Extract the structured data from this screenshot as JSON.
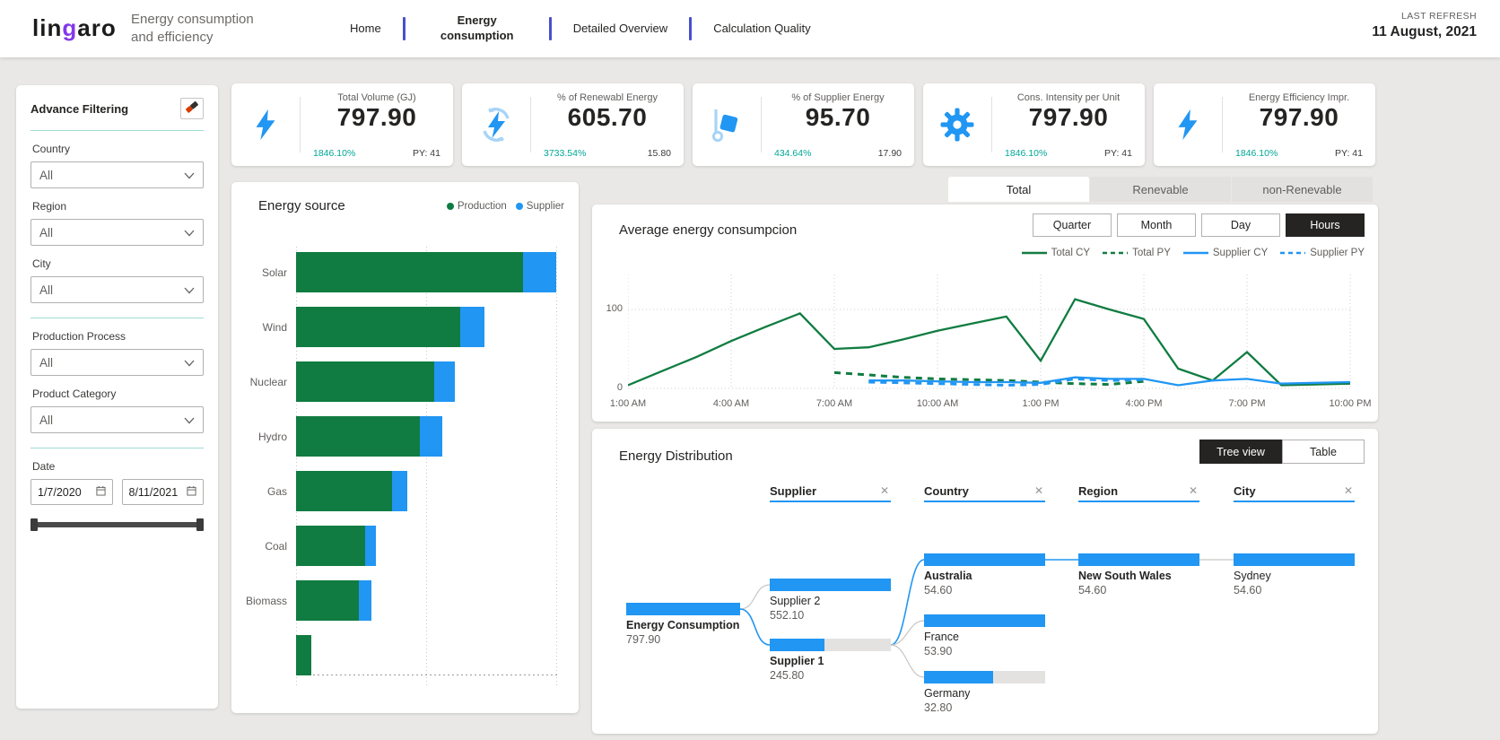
{
  "header": {
    "logo_text": "lingaro",
    "title_line1": "Energy consumption",
    "title_line2": "and efficiency",
    "nav": [
      {
        "label": "Home",
        "active": false
      },
      {
        "label": "Energy consumption",
        "active": true
      },
      {
        "label": "Detailed Overview",
        "active": false
      },
      {
        "label": "Calculation Quality",
        "active": false
      }
    ],
    "last_refresh_label": "LAST REFRESH",
    "last_refresh_date": "11 August, 2021"
  },
  "filters": {
    "title": "Advance Filtering",
    "clear_icon": "eraser-icon",
    "selects": [
      {
        "label": "Country",
        "value": "All"
      },
      {
        "label": "Region",
        "value": "All"
      },
      {
        "label": "City",
        "value": "All"
      },
      {
        "label": "Production Process",
        "value": "All"
      },
      {
        "label": "Product Category",
        "value": "All"
      }
    ],
    "date_label": "Date",
    "date_start": "1/7/2020",
    "date_end": "8/11/2021"
  },
  "kpis": [
    {
      "icon": "bolt-icon",
      "title": "Total Volume (GJ)",
      "value": "797.90",
      "delta": "1846.10%",
      "py": "PY: 41"
    },
    {
      "icon": "renewable-bolt-icon",
      "title": "% of Renewabl Energy",
      "value": "605.70",
      "delta": "3733.54%",
      "py": "15.80"
    },
    {
      "icon": "handtruck-icon",
      "title": "% of Supplier Energy",
      "value": "95.70",
      "delta": "434.64%",
      "py": "17.90"
    },
    {
      "icon": "gear-icon",
      "title": "Cons. Intensity per Unit",
      "value": "797.90",
      "delta": "1846.10%",
      "py": "PY: 41"
    },
    {
      "icon": "bolt-icon",
      "title": "Energy Efficiency Impr.",
      "value": "797.90",
      "delta": "1846.10%",
      "py": "PY: 41"
    }
  ],
  "energy_tabs": [
    {
      "label": "Total",
      "active": true
    },
    {
      "label": "Renevable",
      "active": false
    },
    {
      "label": "non-Renevable",
      "active": false
    }
  ],
  "colors": {
    "production_green": "#107C41",
    "supplier_blue": "#2196F3",
    "delta_green": "#01a796",
    "nav_separator": "#4750ce",
    "logo_purple": "#8338ec"
  },
  "chart_data": [
    {
      "type": "bar",
      "title": "Energy source",
      "orientation": "horizontal",
      "legend": [
        {
          "name": "Production",
          "color": "#107C41"
        },
        {
          "name": "Supplier",
          "color": "#2196F3"
        }
      ],
      "categories": [
        "Solar",
        "Wind",
        "Nuclear",
        "Hydro",
        "Gas",
        "Coal",
        "Biomass",
        ""
      ],
      "series": [
        {
          "name": "Production",
          "values": [
            253,
            183,
            154,
            138,
            107,
            77,
            70,
            17
          ]
        },
        {
          "name": "Supplier",
          "values": [
            37,
            27,
            23,
            25,
            17,
            12,
            14,
            0
          ]
        }
      ],
      "xlim": [
        0,
        290
      ],
      "grid": "dotted-vertical"
    },
    {
      "type": "line",
      "title": "Average energy consumpcion",
      "time_buttons": [
        {
          "label": "Quarter",
          "active": false
        },
        {
          "label": "Month",
          "active": false
        },
        {
          "label": "Day",
          "active": false
        },
        {
          "label": "Hours",
          "active": true
        }
      ],
      "x_labels": [
        "1:00 AM",
        "4:00 AM",
        "7:00 AM",
        "10:00 AM",
        "1:00 PM",
        "4:00 PM",
        "7:00 PM",
        "10:00 PM"
      ],
      "x_points": 22,
      "ylim": [
        0,
        125
      ],
      "yticks": [
        "100",
        "0"
      ],
      "grid": "dotted",
      "legend_position": "top-right",
      "series": [
        {
          "name": "Total CY",
          "color": "#107C41",
          "dashed": false,
          "values": [
            4,
            22,
            40,
            60,
            78,
            95,
            50,
            52,
            62,
            73,
            82,
            91,
            35,
            113,
            100,
            88,
            25,
            10,
            46,
            4,
            5,
            6
          ]
        },
        {
          "name": "Total PY",
          "color": "#107C41",
          "dashed": true,
          "values": [
            null,
            null,
            null,
            null,
            null,
            null,
            20,
            17,
            14,
            12,
            11,
            10,
            8,
            6,
            5,
            9,
            null,
            null,
            null,
            null,
            null,
            null
          ]
        },
        {
          "name": "Supplier CY",
          "color": "#2196F3",
          "dashed": false,
          "values": [
            null,
            null,
            null,
            null,
            null,
            null,
            null,
            10,
            10,
            9,
            8,
            8,
            7,
            14,
            12,
            12,
            4,
            10,
            12,
            6,
            7,
            8
          ]
        },
        {
          "name": "Supplier PY",
          "color": "#2196F3",
          "dashed": true,
          "values": [
            null,
            null,
            null,
            null,
            null,
            null,
            null,
            8,
            7,
            6,
            5,
            4,
            5,
            12,
            10,
            11,
            null,
            null,
            null,
            null,
            null,
            null
          ]
        }
      ]
    },
    {
      "type": "tree",
      "title": "Energy Distribution",
      "columns": [
        "Supplier",
        "Country",
        "Region",
        "City"
      ],
      "nodes": [
        {
          "id": "root",
          "label": "Energy Consumption",
          "value": "797.90",
          "bold": true,
          "fill": 1
        },
        {
          "id": "sup2",
          "label": "Supplier 2",
          "value": "552.10",
          "bold": false,
          "fill": 1
        },
        {
          "id": "sup1",
          "label": "Supplier 1",
          "value": "245.80",
          "bold": true,
          "fill": 0.45
        },
        {
          "id": "australia",
          "label": "Australia",
          "value": "54.60",
          "bold": true,
          "fill": 1
        },
        {
          "id": "france",
          "label": "France",
          "value": "53.90",
          "bold": false,
          "fill": 1
        },
        {
          "id": "germany",
          "label": "Germany",
          "value": "32.80",
          "bold": false,
          "fill": 0.57
        },
        {
          "id": "nsw",
          "label": "New South Wales",
          "value": "54.60",
          "bold": true,
          "fill": 1
        },
        {
          "id": "sydney",
          "label": "Sydney",
          "value": "54.60",
          "bold": false,
          "fill": 1
        }
      ],
      "edges": [
        {
          "from": "root",
          "to": "sup2",
          "active": false
        },
        {
          "from": "root",
          "to": "sup1",
          "active": true
        },
        {
          "from": "sup1",
          "to": "australia",
          "active": true
        },
        {
          "from": "sup1",
          "to": "france",
          "active": false
        },
        {
          "from": "sup1",
          "to": "germany",
          "active": false
        },
        {
          "from": "australia",
          "to": "nsw",
          "active": true
        },
        {
          "from": "nsw",
          "to": "sydney",
          "active": false
        }
      ]
    }
  ],
  "distribution": {
    "title": "Energy Distribution",
    "view_buttons": [
      {
        "label": "Tree view",
        "active": true
      },
      {
        "label": "Table",
        "active": false
      }
    ]
  }
}
